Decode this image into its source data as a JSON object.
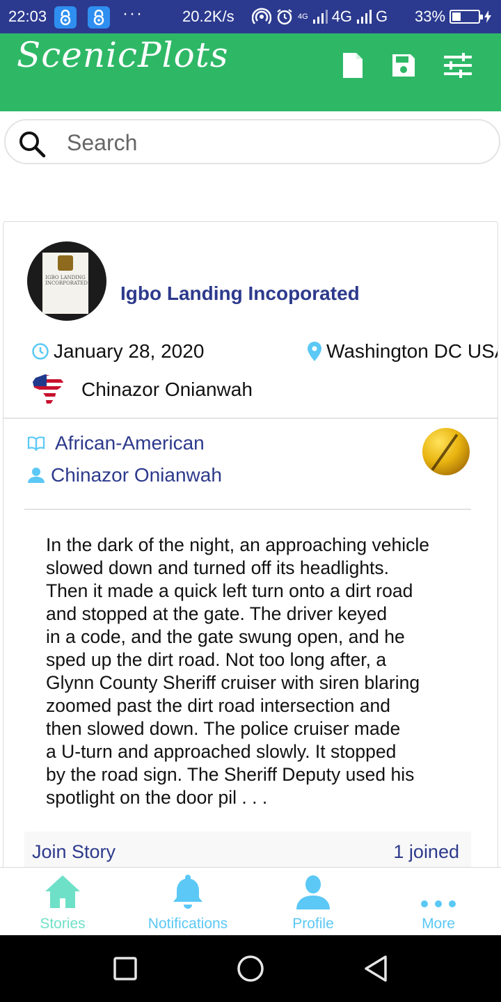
{
  "status_bar": {
    "time": "22:03",
    "more_dots": "···",
    "net_speed": "20.2K/s",
    "network_4g_small": "4G",
    "network_4g": "4G",
    "network_g": "G",
    "battery_text": "33%",
    "battery_level": 0.33
  },
  "header": {
    "logo": "ScenicPlots",
    "actions": [
      "document-icon",
      "save-icon",
      "sliders-icon"
    ],
    "color": "#2eb866"
  },
  "search": {
    "placeholder": "Search"
  },
  "story_card": {
    "org_name": "Igbo Landing Incoporated",
    "avatar_text": "IGBO LANDING INCORPORATED",
    "date": "January 28, 2020",
    "location": "Washington DC USA",
    "author": "Chinazor Onianwah",
    "category": "African-American",
    "byline": "Chinazor Onianwah",
    "body": "In the dark of the night, an approaching vehicle\nslowed down and turned off its headlights.\nThen it made a quick left turn onto a dirt road\nand stopped at the gate. The driver keyed\nin a code, and the gate swung open, and he\nsped up the dirt road. Not too long after, a\nGlynn County Sheriff cruiser with siren blaring\nzoomed past the dirt road intersection and\nthen slowed down. The police cruiser made\na U-turn and approached slowly. It stopped\nby the road sign. The Sheriff Deputy used his\nspotlight on the door pil . . .",
    "join_label": "Join Story",
    "joined_text": "1 joined"
  },
  "bottom_nav": {
    "items": [
      {
        "label": "Stories",
        "icon": "home-icon",
        "active": true
      },
      {
        "label": "Notifications",
        "icon": "bell-icon",
        "active": false
      },
      {
        "label": "Profile",
        "icon": "person-icon",
        "active": false
      },
      {
        "label": "More",
        "icon": "more-dots-icon",
        "active": false
      }
    ]
  },
  "system_nav": [
    "recents-square-icon",
    "home-circle-icon",
    "back-triangle-icon"
  ],
  "colors": {
    "status_bar": "#2b3a8f",
    "accent_blue": "#2d3a8c",
    "nav_icon": "#5bc8f5",
    "nav_active": "#6ee0c8"
  }
}
